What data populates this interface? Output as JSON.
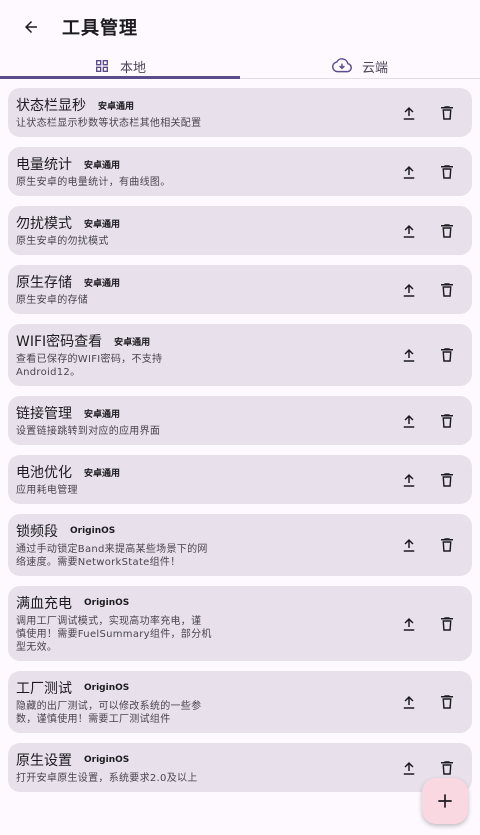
{
  "header": {
    "title": "工具管理"
  },
  "tabs": [
    {
      "label": "本地",
      "icon": "grid-icon",
      "active": true
    },
    {
      "label": "云端",
      "icon": "cloud-download-icon",
      "active": false
    }
  ],
  "tools": [
    {
      "name": "状态栏显秒",
      "tag": "安卓通用",
      "desc": [
        "让状态栏显示秒数等状态栏其他相关配置"
      ]
    },
    {
      "name": "电量统计",
      "tag": "安卓通用",
      "desc": [
        "原生安卓的电量统计，有曲线图。"
      ]
    },
    {
      "name": "勿扰模式",
      "tag": "安卓通用",
      "desc": [
        "原生安卓的勿扰模式"
      ]
    },
    {
      "name": "原生存储",
      "tag": "安卓通用",
      "desc": [
        "原生安卓的存储"
      ]
    },
    {
      "name": "WIFI密码查看",
      "tag": "安卓通用",
      "desc": [
        "查看已保存的WIFI密码，不支持",
        "Android12。"
      ]
    },
    {
      "name": "链接管理",
      "tag": "安卓通用",
      "desc": [
        "设置链接跳转到对应的应用界面"
      ]
    },
    {
      "name": "电池优化",
      "tag": "安卓通用",
      "desc": [
        "应用耗电管理"
      ]
    },
    {
      "name": "锁频段",
      "tag": "OriginOS",
      "desc": [
        "通过手动锁定Band来提高某些场景下的网",
        "络速度。需要NetworkState组件！"
      ]
    },
    {
      "name": "满血充电",
      "tag": "OriginOS",
      "desc": [
        "调用工厂调试模式，实现高功率充电，谨",
        "慎使用！需要FuelSummary组件，部分机",
        "型无效。"
      ]
    },
    {
      "name": "工厂测试",
      "tag": "OriginOS",
      "desc": [
        "隐藏的出厂测试，可以修改系统的一些参",
        "数，谨慎使用！需要工厂测试组件"
      ]
    },
    {
      "name": "原生设置",
      "tag": "OriginOS",
      "desc": [
        "打开安卓原生设置，系统要求2.0及以上"
      ]
    }
  ],
  "icons": {
    "back": "arrow-left-icon",
    "upload": "upload-icon",
    "delete": "trash-icon",
    "add": "plus-icon"
  },
  "colors": {
    "background": "#fdf9fe",
    "card": "#e8e1ec",
    "accent": "#5b4c8c",
    "fab": "#f9d8e2"
  }
}
